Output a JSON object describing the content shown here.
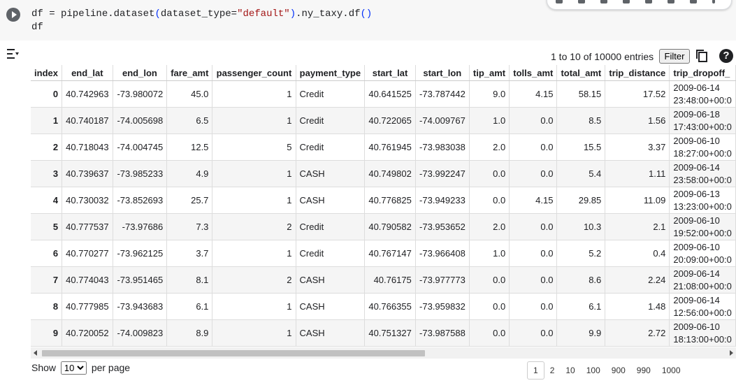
{
  "code_cell": {
    "line1_prefix": "df = pipeline.dataset",
    "line1_paren_open": "(",
    "line1_arg": "dataset_type=",
    "line1_string": "\"default\"",
    "line1_paren_close": ")",
    "line1_suffix": ".ny_taxy.df",
    "line1_call": "()",
    "line2": "df"
  },
  "table_toolbar": {
    "entries_info": "1 to 10 of 10000 entries",
    "filter_label": "Filter",
    "help_label": "?"
  },
  "columns": [
    "index",
    "end_lat",
    "end_lon",
    "fare_amt",
    "passenger_count",
    "payment_type",
    "start_lat",
    "start_lon",
    "tip_amt",
    "tolls_amt",
    "total_amt",
    "trip_distance",
    "trip_dropoff_"
  ],
  "rows": [
    [
      "0",
      "40.742963",
      "-73.980072",
      "45.0",
      "1",
      "Credit",
      "40.641525",
      "-73.787442",
      "9.0",
      "4.15",
      "58.15",
      "17.52",
      "2009-06-14",
      "23:48:00+00:0"
    ],
    [
      "1",
      "40.740187",
      "-74.005698",
      "6.5",
      "1",
      "Credit",
      "40.722065",
      "-74.009767",
      "1.0",
      "0.0",
      "8.5",
      "1.56",
      "2009-06-18",
      "17:43:00+00:0"
    ],
    [
      "2",
      "40.718043",
      "-74.004745",
      "12.5",
      "5",
      "Credit",
      "40.761945",
      "-73.983038",
      "2.0",
      "0.0",
      "15.5",
      "3.37",
      "2009-06-10",
      "18:27:00+00:0"
    ],
    [
      "3",
      "40.739637",
      "-73.985233",
      "4.9",
      "1",
      "CASH",
      "40.749802",
      "-73.992247",
      "0.0",
      "0.0",
      "5.4",
      "1.11",
      "2009-06-14",
      "23:58:00+00:0"
    ],
    [
      "4",
      "40.730032",
      "-73.852693",
      "25.7",
      "1",
      "CASH",
      "40.776825",
      "-73.949233",
      "0.0",
      "4.15",
      "29.85",
      "11.09",
      "2009-06-13",
      "13:23:00+00:0"
    ],
    [
      "5",
      "40.777537",
      "-73.97686",
      "7.3",
      "2",
      "Credit",
      "40.790582",
      "-73.953652",
      "2.0",
      "0.0",
      "10.3",
      "2.1",
      "2009-06-10",
      "19:52:00+00:0"
    ],
    [
      "6",
      "40.770277",
      "-73.962125",
      "3.7",
      "1",
      "Credit",
      "40.767147",
      "-73.966408",
      "1.0",
      "0.0",
      "5.2",
      "0.4",
      "2009-06-10",
      "20:09:00+00:0"
    ],
    [
      "7",
      "40.774043",
      "-73.951465",
      "8.1",
      "2",
      "CASH",
      "40.76175",
      "-73.977773",
      "0.0",
      "0.0",
      "8.6",
      "2.24",
      "2009-06-14",
      "21:08:00+00:0"
    ],
    [
      "8",
      "40.777985",
      "-73.943683",
      "6.1",
      "1",
      "CASH",
      "40.766355",
      "-73.959832",
      "0.0",
      "0.0",
      "6.1",
      "1.48",
      "2009-06-14",
      "12:56:00+00:0"
    ],
    [
      "9",
      "40.720052",
      "-74.009823",
      "8.9",
      "1",
      "CASH",
      "40.751327",
      "-73.987588",
      "0.0",
      "0.0",
      "9.9",
      "2.72",
      "2009-06-10",
      "18:13:00+00:0"
    ]
  ],
  "footer": {
    "show_label": "Show",
    "per_page_value": "10",
    "per_page_options": [
      "10"
    ],
    "per_page_label": "per page",
    "pages": [
      "1",
      "2",
      "10",
      "100",
      "900",
      "990",
      "1000"
    ],
    "active_page": "1"
  }
}
